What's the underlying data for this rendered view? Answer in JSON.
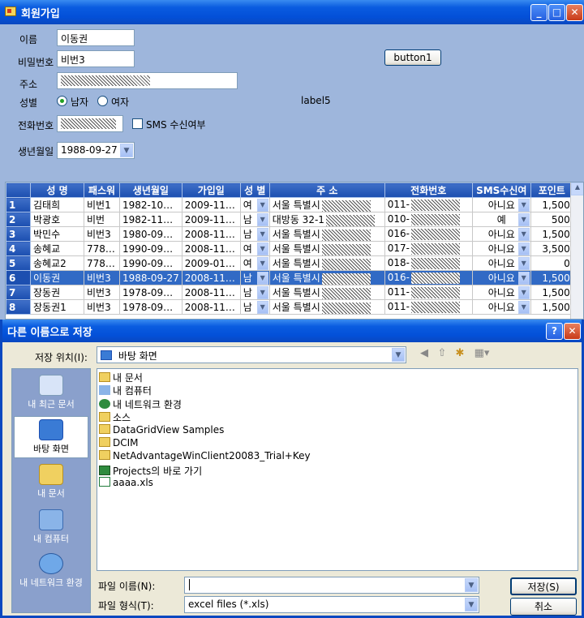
{
  "main_window": {
    "title": "회원가입",
    "form": {
      "name_label": "이름",
      "name_value": "이동권",
      "password_label": "비밀번호",
      "password_value": "비번3",
      "address_label": "주소",
      "gender_label": "성별",
      "gender_options": [
        "남자",
        "여자"
      ],
      "gender_selected": "남자",
      "label5": "label5",
      "phone_label": "전화번호",
      "sms_label": "SMS 수신여부",
      "birth_label": "생년월일",
      "birth_value": "1988-09-27",
      "button1": "button1"
    }
  },
  "grid": {
    "columns": [
      "성 명",
      "패스워",
      "생년월일",
      "가입일",
      "성 별",
      "주 소",
      "전화번호",
      "SMS수신여",
      "포인트"
    ],
    "rows": [
      {
        "n": "1",
        "name": "김태희",
        "pw": "비번1",
        "birth": "1982-10…",
        "join": "2009-11…",
        "sex": "여",
        "addr": "서울 특별시",
        "tel": "011-",
        "sms": "아니요",
        "pt": "1,500"
      },
      {
        "n": "2",
        "name": "박광호",
        "pw": "비번",
        "birth": "1982-11…",
        "join": "2009-11…",
        "sex": "남",
        "addr": "대방동 32-1",
        "tel": "010-",
        "sms": "예",
        "pt": "500"
      },
      {
        "n": "3",
        "name": "박민수",
        "pw": "비번3",
        "birth": "1980-09…",
        "join": "2008-11…",
        "sex": "남",
        "addr": "서울 특별시",
        "tel": "016-",
        "sms": "아니요",
        "pt": "1,500"
      },
      {
        "n": "4",
        "name": "송혜교",
        "pw": "778…",
        "birth": "1990-09…",
        "join": "2008-11…",
        "sex": "여",
        "addr": "서울 특별시",
        "tel": "017-",
        "sms": "아니요",
        "pt": "3,500"
      },
      {
        "n": "5",
        "name": "송혜교2",
        "pw": "778…",
        "birth": "1990-09…",
        "join": "2009-01…",
        "sex": "여",
        "addr": "서울 특별시",
        "tel": "018-",
        "sms": "아니요",
        "pt": "0"
      },
      {
        "n": "6",
        "name": "이동권",
        "pw": "비번3",
        "birth": "1988-09-27",
        "join": "2008-11…",
        "sex": "남",
        "addr": "서울 특별시",
        "tel": "016-",
        "sms": "아니요",
        "pt": "1,500",
        "selected": true
      },
      {
        "n": "7",
        "name": "장동권",
        "pw": "비번3",
        "birth": "1978-09…",
        "join": "2008-11…",
        "sex": "남",
        "addr": "서울 특별시",
        "tel": "011-",
        "sms": "아니요",
        "pt": "1,500"
      },
      {
        "n": "8",
        "name": "장동권1",
        "pw": "비번3",
        "birth": "1978-09…",
        "join": "2008-11…",
        "sex": "남",
        "addr": "서울 특별시",
        "tel": "011-",
        "sms": "아니요",
        "pt": "1,500"
      }
    ]
  },
  "save_dialog": {
    "title": "다른 이름으로 저장",
    "save_in_label": "저장 위치(I):",
    "save_in_value": "바탕 화면",
    "places": [
      "내 최근 문서",
      "바탕 화면",
      "내 문서",
      "내 컴퓨터",
      "내 네트워크 환경"
    ],
    "places_selected": "바탕 화면",
    "files": [
      {
        "name": "내 문서",
        "icon": "my-documents-icon"
      },
      {
        "name": "내 컴퓨터",
        "icon": "my-computer-icon"
      },
      {
        "name": "내 네트워크 환경",
        "icon": "network-icon"
      },
      {
        "name": "소스",
        "icon": "folder-icon"
      },
      {
        "name": "DataGridView Samples",
        "icon": "folder-icon"
      },
      {
        "name": "DCIM",
        "icon": "folder-icon"
      },
      {
        "name": "NetAdvantageWinClient20083_Trial+Key",
        "icon": "folder-icon"
      },
      {
        "name": "Projects의 바로 가기",
        "icon": "shortcut-icon"
      },
      {
        "name": "aaaa.xls",
        "icon": "excel-file-icon"
      }
    ],
    "filename_label": "파일 이름(N):",
    "filename_value": "",
    "filetype_label": "파일 형식(T):",
    "filetype_value": "excel files (*.xls)",
    "save_button": "저장(S)",
    "cancel_button": "취소"
  }
}
